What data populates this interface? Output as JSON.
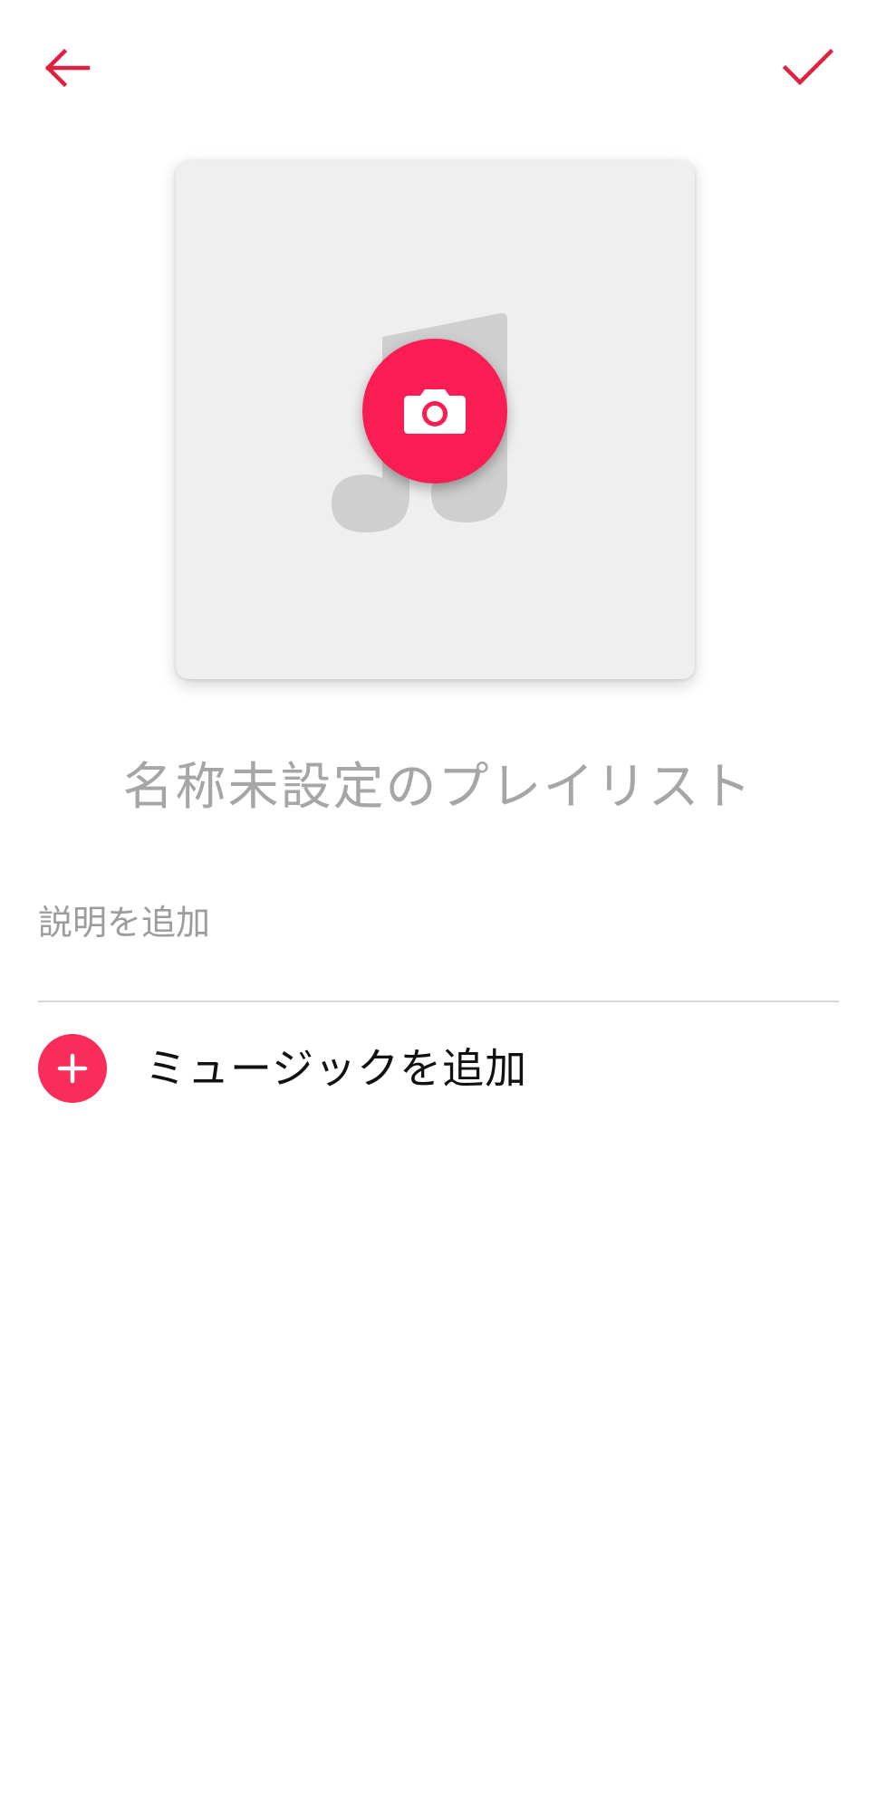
{
  "colors": {
    "accent": "#e0203f",
    "fab": "#fa1d54",
    "add_circle": "#fa2d5a",
    "artwork_bg": "#efefef",
    "placeholder_text": "#a6a6a6"
  },
  "toolbar": {
    "back_icon": "arrow-left",
    "done_icon": "checkmark"
  },
  "artwork": {
    "placeholder_icon": "music-note",
    "camera_icon": "camera"
  },
  "playlist": {
    "title_placeholder": "名称未設定のプレイリスト",
    "description_placeholder": "説明を追加"
  },
  "actions": {
    "add_music_label": "ミュージックを追加",
    "add_icon": "plus"
  }
}
